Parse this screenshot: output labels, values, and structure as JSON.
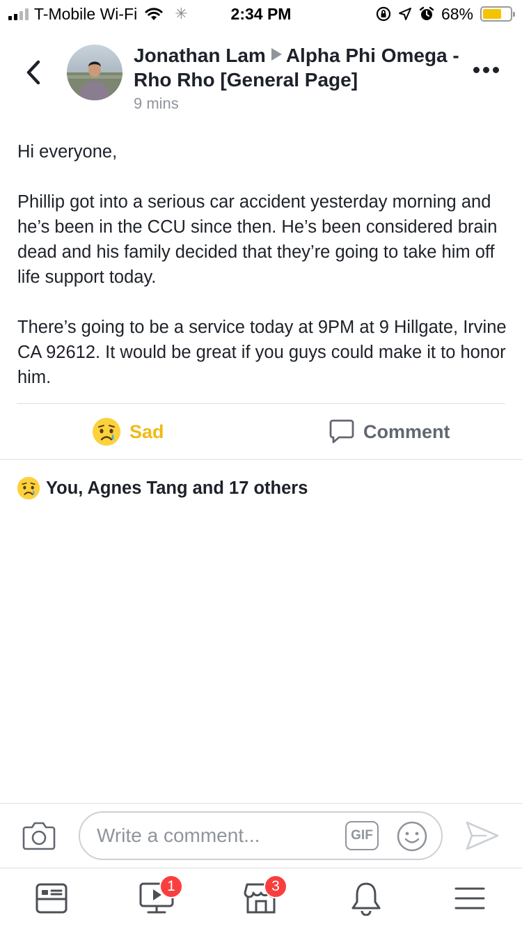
{
  "status_bar": {
    "carrier": "T-Mobile Wi-Fi",
    "time": "2:34 PM",
    "battery_percent": "68%",
    "battery_level": 0.68,
    "battery_color": "#f5c400",
    "icons": [
      "signal-icon",
      "wifi-icon",
      "activity-spinner-icon",
      "screen-rotation-lock-icon",
      "location-arrow-icon",
      "alarm-icon",
      "battery-icon"
    ]
  },
  "header": {
    "author": "Jonathan Lam",
    "group": "Alpha Phi Omega - Rho Rho [General Page]",
    "timestamp": "9 mins"
  },
  "post": {
    "paragraphs": [
      "Hi everyone,",
      "Phillip got into a serious car accident yesterday morning and he’s been in the CCU since then. He’s been considered brain dead and his family decided that they’re going to take him off life support today.",
      "There’s going to be a service today at 9PM at 9 Hillgate, Irvine CA 92612. It would be great if you guys could make it to honor him."
    ]
  },
  "actions": {
    "reaction_label": "Sad",
    "comment_label": "Comment",
    "reaction_color": "#f0ba15"
  },
  "reactions_summary": "You, Agnes Tang and 17 others",
  "composer": {
    "placeholder": "Write a comment...",
    "gif_label": "GIF"
  },
  "tab_bar": {
    "video_badge": "1",
    "marketplace_badge": "3",
    "badge_color": "#fa3e3e"
  }
}
